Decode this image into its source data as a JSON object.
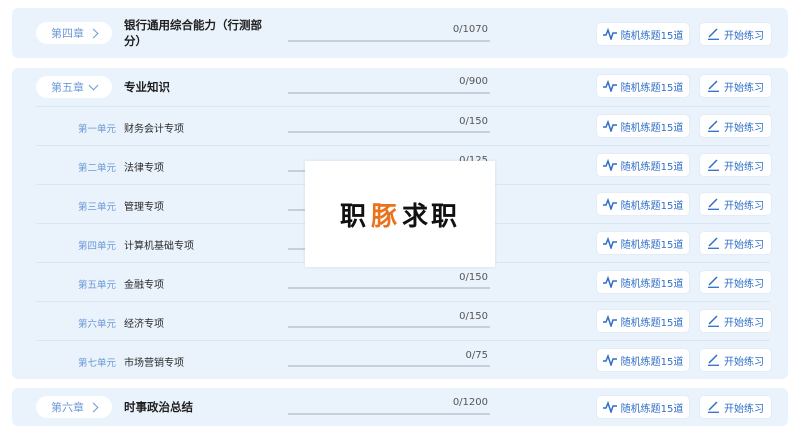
{
  "chapters": [
    {
      "button_label": "第四章",
      "title": "银行通用综合能力（行测部分）",
      "progress": "0/1070",
      "progress_fraction": 0,
      "random_label": "随机练题15道",
      "start_label": "开始练习",
      "expanded": false
    },
    {
      "button_label": "第五章",
      "title": "专业知识",
      "progress": "0/900",
      "progress_fraction": 0,
      "random_label": "随机练题15道",
      "start_label": "开始练习",
      "expanded": true,
      "units": [
        {
          "label": "第一单元",
          "title": "财务会计专项",
          "progress": "0/150",
          "progress_fraction": 0
        },
        {
          "label": "第二单元",
          "title": "法律专项",
          "progress": "0/125",
          "progress_fraction": 0
        },
        {
          "label": "第三单元",
          "title": "管理专项",
          "progress": "",
          "progress_fraction": 0
        },
        {
          "label": "第四单元",
          "title": "计算机基础专项",
          "progress": "",
          "progress_fraction": 0
        },
        {
          "label": "第五单元",
          "title": "金融专项",
          "progress": "0/150",
          "progress_fraction": 0
        },
        {
          "label": "第六单元",
          "title": "经济专项",
          "progress": "0/150",
          "progress_fraction": 0
        },
        {
          "label": "第七单元",
          "title": "市场营销专项",
          "progress": "0/75",
          "progress_fraction": 0
        }
      ]
    },
    {
      "button_label": "第六章",
      "title": "时事政治总结",
      "progress": "0/1200",
      "progress_fraction": 0,
      "random_label": "随机练题15道",
      "start_label": "开始练习",
      "expanded": false
    }
  ],
  "unit_buttons": {
    "random_label": "随机练题15道",
    "start_label": "开始练习"
  },
  "watermark": {
    "part1": "职",
    "part2": "豚",
    "part3": "求职"
  },
  "colors": {
    "card_bg": "#eaf3fc",
    "accent_blue": "#2f6fc8",
    "light_blue_text": "#6b9ad6",
    "watermark_orange": "#e8731c"
  }
}
